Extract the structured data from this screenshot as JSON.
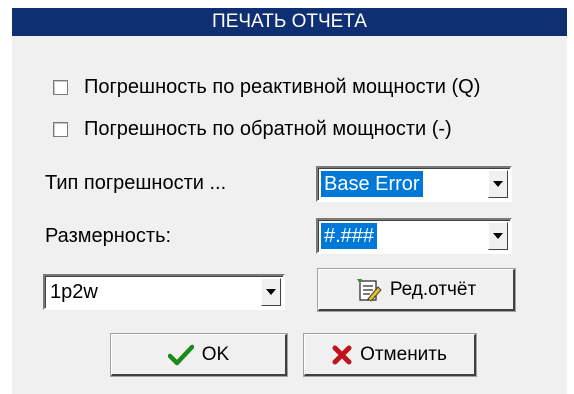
{
  "dialog": {
    "title": "ПЕЧАТЬ ОТЧЕТА"
  },
  "checkboxes": [
    {
      "label": "Погрешность по реактивной мощности (Q)",
      "checked": false
    },
    {
      "label": "Погрешность по обратной мощности (-)",
      "checked": false
    }
  ],
  "error_type": {
    "label": "Тип погрешности ...",
    "value": "Base Error"
  },
  "dimension": {
    "label": "Размерность:",
    "value": "#.###"
  },
  "wiring": {
    "value": "1p2w"
  },
  "buttons": {
    "edit_report": "Ред.отчёт",
    "ok": "OK",
    "cancel": "Отменить"
  },
  "colors": {
    "title_bar": "#0f2f73",
    "selection": "#0078d7",
    "ok_icon": "#1a8a1a",
    "cancel_icon": "#c0141c"
  },
  "icons": {
    "ok": "checkmark-icon",
    "cancel": "cross-icon",
    "edit_report": "report-edit-icon",
    "dropdown": "chevron-down-icon"
  }
}
